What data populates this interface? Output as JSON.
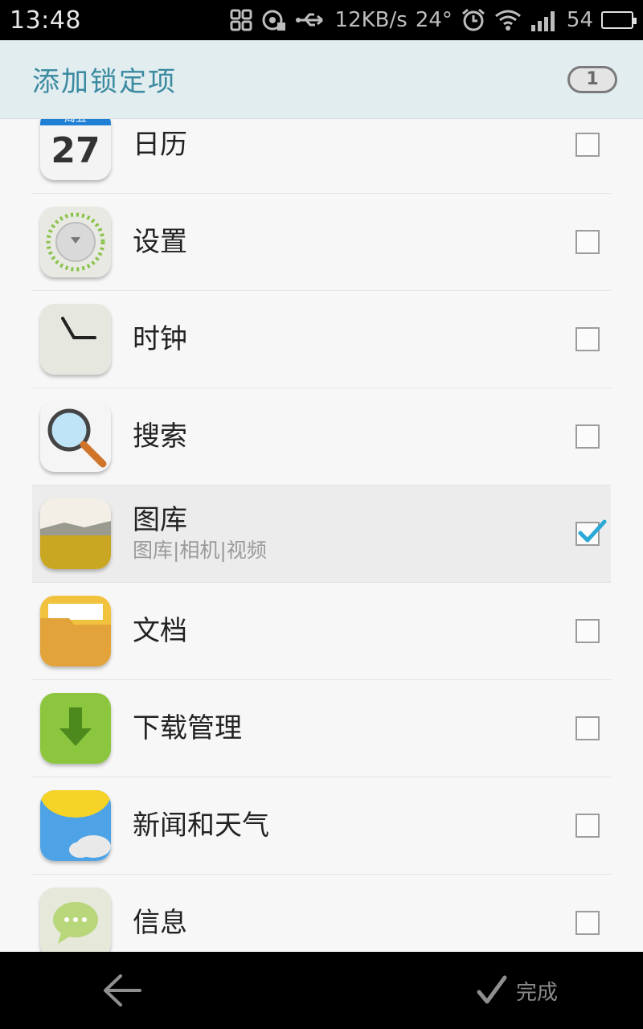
{
  "status_bar": {
    "time": "13:48",
    "network_speed": "12KB/s",
    "temperature": "24°",
    "battery_level": "54",
    "battery_color": "#55c12a"
  },
  "header": {
    "title": "添加锁定项",
    "selected_count": "1",
    "title_color": "#3a8aa0",
    "background": "#e2edf0"
  },
  "apps": [
    {
      "label": "日历",
      "icon": "calendar-icon",
      "calendar_weekday": "周五",
      "calendar_day": "27",
      "checked": false
    },
    {
      "label": "设置",
      "icon": "settings-icon",
      "checked": false
    },
    {
      "label": "时钟",
      "icon": "clock-icon",
      "checked": false
    },
    {
      "label": "搜索",
      "icon": "search-icon",
      "checked": false
    },
    {
      "label": "图库",
      "sublabel": "图库|相机|视频",
      "icon": "gallery-icon",
      "checked": true
    },
    {
      "label": "文档",
      "icon": "folder-icon",
      "checked": false
    },
    {
      "label": "下载管理",
      "icon": "download-icon",
      "checked": false
    },
    {
      "label": "新闻和天气",
      "icon": "weather-icon",
      "checked": false
    },
    {
      "label": "信息",
      "icon": "message-icon",
      "checked": false
    }
  ],
  "bottom_bar": {
    "back_icon": "back-arrow-icon",
    "done_icon": "checkmark-icon",
    "done_label": "完成"
  },
  "accent_check_color": "#2aa9d6"
}
